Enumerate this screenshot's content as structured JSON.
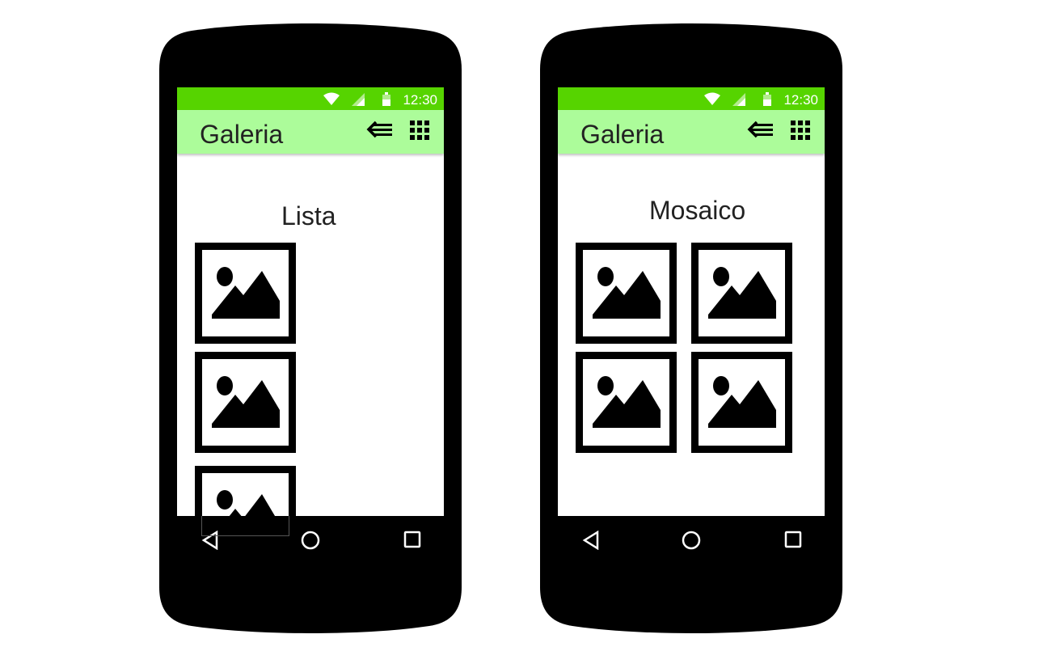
{
  "colors": {
    "status_bar": "#56d400",
    "app_bar": "#acfc9a",
    "phone_body": "#000000",
    "screen": "#ffffff"
  },
  "phones": [
    {
      "status_time": "12:30",
      "app_title": "Galeria",
      "mode_label": "Lista",
      "layout": "list",
      "image_count": 3,
      "toolbar_icons": [
        "list-view-icon",
        "grid-view-icon"
      ],
      "nav_icons": [
        "back-icon",
        "home-icon",
        "recents-icon"
      ]
    },
    {
      "status_time": "12:30",
      "app_title": "Galeria",
      "mode_label": "Mosaico",
      "layout": "grid",
      "image_count": 4,
      "toolbar_icons": [
        "list-view-icon",
        "grid-view-icon"
      ],
      "nav_icons": [
        "back-icon",
        "home-icon",
        "recents-icon"
      ]
    }
  ]
}
